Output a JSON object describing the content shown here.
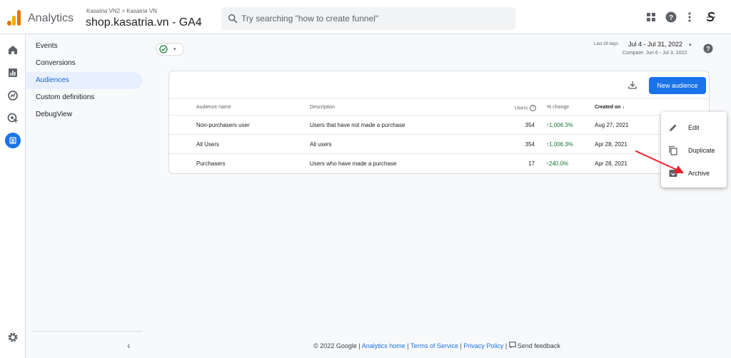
{
  "header": {
    "app_title": "Analytics",
    "account_path": "Kasatria VN2 > Kasatria VN",
    "property_name": "shop.kasatria.vn - GA4",
    "property_caret": "▾",
    "search_placeholder": "Try searching \"how to create funnel\"",
    "icons": [
      "apps-grid-icon",
      "help-icon",
      "more-vert-icon",
      "account-avatar-icon"
    ]
  },
  "rail": {
    "icons": [
      "home-icon",
      "reports-icon",
      "explore-icon",
      "advertising-icon",
      "configure-icon",
      "settings-icon"
    ],
    "active": "configure-icon"
  },
  "nav": {
    "items": [
      {
        "label": "Events",
        "active": false
      },
      {
        "label": "Conversions",
        "active": false
      },
      {
        "label": "Audiences",
        "active": true
      },
      {
        "label": "Custom definitions",
        "active": false
      },
      {
        "label": "DebugView",
        "active": false
      }
    ],
    "collapse_glyph": "‹"
  },
  "date": {
    "last_label": "Last 28 days",
    "range": "Jul 4 - Jul 31, 2022",
    "caret": "▾",
    "compare": "Compare: Jun 6 - Jul 3, 2022"
  },
  "filter_chip": {
    "caret": "▾"
  },
  "toolbar": {
    "new_audience_label": "New audience"
  },
  "table": {
    "headers": {
      "name": "Audience name",
      "description": "Description",
      "users": "Users",
      "users_info": "?",
      "change": "% change",
      "created": "Created on",
      "sort_glyph": "↓"
    },
    "rows": [
      {
        "name": "Non-purchasers user",
        "description": "Users that have not made a purchase",
        "users": "354",
        "change": "↑1,006.3%",
        "created": "Aug 27, 2021"
      },
      {
        "name": "All Users",
        "description": "All users",
        "users": "354",
        "change": "↑1,006.3%",
        "created": "Apr 28, 2021"
      },
      {
        "name": "Purchasers",
        "description": "Users who have made a purchase",
        "users": "17",
        "change": "↑240.0%",
        "created": "Apr 28, 2021"
      }
    ]
  },
  "context_menu": {
    "items": [
      {
        "label": "Edit",
        "icon": "edit-icon"
      },
      {
        "label": "Duplicate",
        "icon": "duplicate-icon"
      },
      {
        "label": "Archive",
        "icon": "archive-icon"
      }
    ]
  },
  "colors": {
    "accent": "#1a73e8",
    "active_nav_bg": "#e8f0fe",
    "positive": "#137333",
    "annotation_arrow": "#e8202a"
  },
  "footer": {
    "copyright": "© 2022 Google",
    "sep": "|",
    "links": [
      "Analytics home",
      "Terms of Service",
      "Privacy Policy"
    ],
    "feedback": "Send feedback"
  }
}
